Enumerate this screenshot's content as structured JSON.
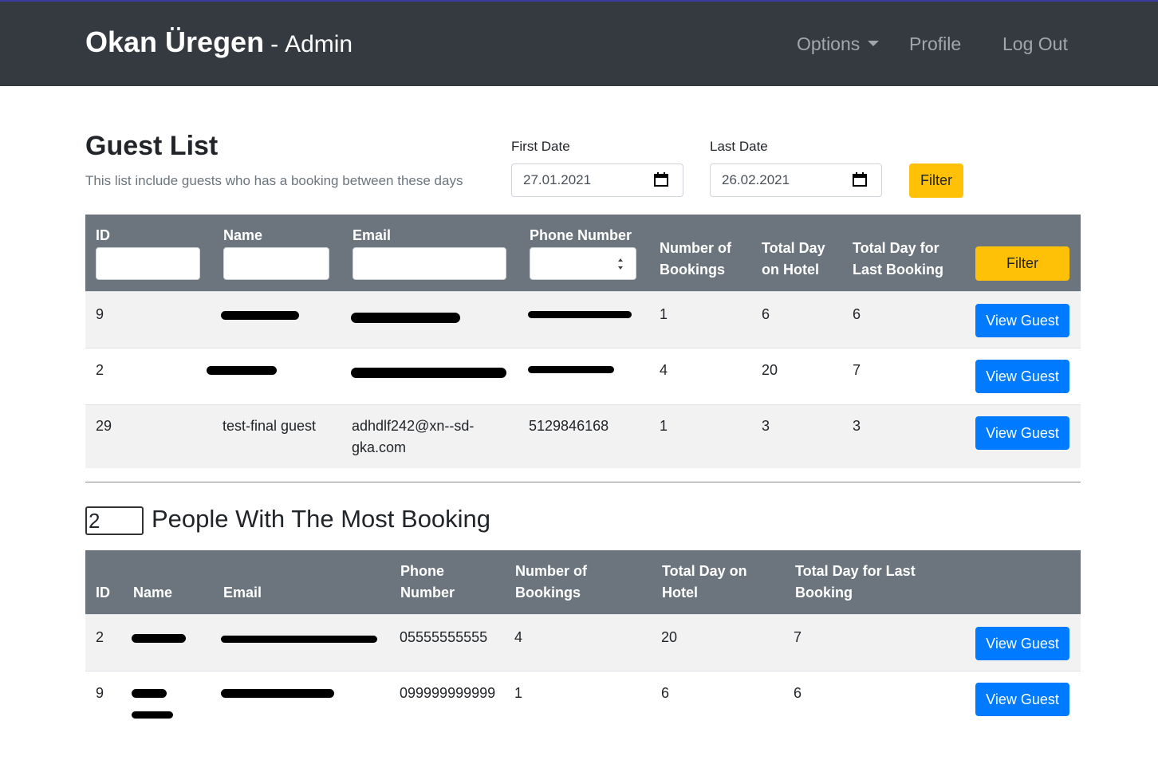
{
  "nav": {
    "brand_name": "Okan Üregen",
    "brand_sep": "-",
    "brand_role": "Admin",
    "options": "Options",
    "profile": "Profile",
    "logout": "Log Out"
  },
  "guest_list": {
    "title": "Guest List",
    "subtitle": "This list include guests who has a booking between these days",
    "first_date_label": "First Date",
    "first_date_value": "27.01.2021",
    "last_date_label": "Last Date",
    "last_date_value": "26.02.2021",
    "filter_label": "Filter",
    "headers": {
      "id": "ID",
      "name": "Name",
      "email": "Email",
      "phone": "Phone Number",
      "bookings_1": "Number of",
      "bookings_2": "Bookings",
      "total_1": "Total Day",
      "total_2": "on Hotel",
      "last_1": "Total Day for",
      "last_2": "Last Booking"
    },
    "header_filter_label": "Filter",
    "rows": [
      {
        "id": "9",
        "name": "",
        "email": "",
        "phone": "",
        "bookings": "1",
        "total": "6",
        "last": "6",
        "action": "View Guest"
      },
      {
        "id": "2",
        "name": "",
        "email": "",
        "phone": "",
        "bookings": "4",
        "total": "20",
        "last": "7",
        "action": "View Guest"
      },
      {
        "id": "29",
        "name": "test-final guest",
        "email_1": "adhdlf242@xn--sd-",
        "email_2": "gka.com",
        "phone": "5129846168",
        "bookings": "1",
        "total": "3",
        "last": "3",
        "action": "View Guest"
      }
    ]
  },
  "top_bookers": {
    "count": "2",
    "title": "People With The Most Booking",
    "headers": {
      "id": "ID",
      "name": "Name",
      "email": "Email",
      "phone_1": "Phone",
      "phone_2": "Number",
      "bookings_1": "Number of",
      "bookings_2": "Bookings",
      "total_1": "Total Day on",
      "total_2": "Hotel",
      "last_1": "Total Day for Last",
      "last_2": "Booking"
    },
    "rows": [
      {
        "id": "2",
        "phone": "05555555555",
        "bookings": "4",
        "total": "20",
        "last": "7",
        "action": "View Guest"
      },
      {
        "id": "9",
        "phone": "099999999999",
        "bookings": "1",
        "total": "6",
        "last": "6",
        "action": "View Guest"
      }
    ]
  },
  "colors": {
    "navbar": "#343a40",
    "table_header": "#6c757d",
    "warning": "#ffc107",
    "primary": "#007bff"
  }
}
